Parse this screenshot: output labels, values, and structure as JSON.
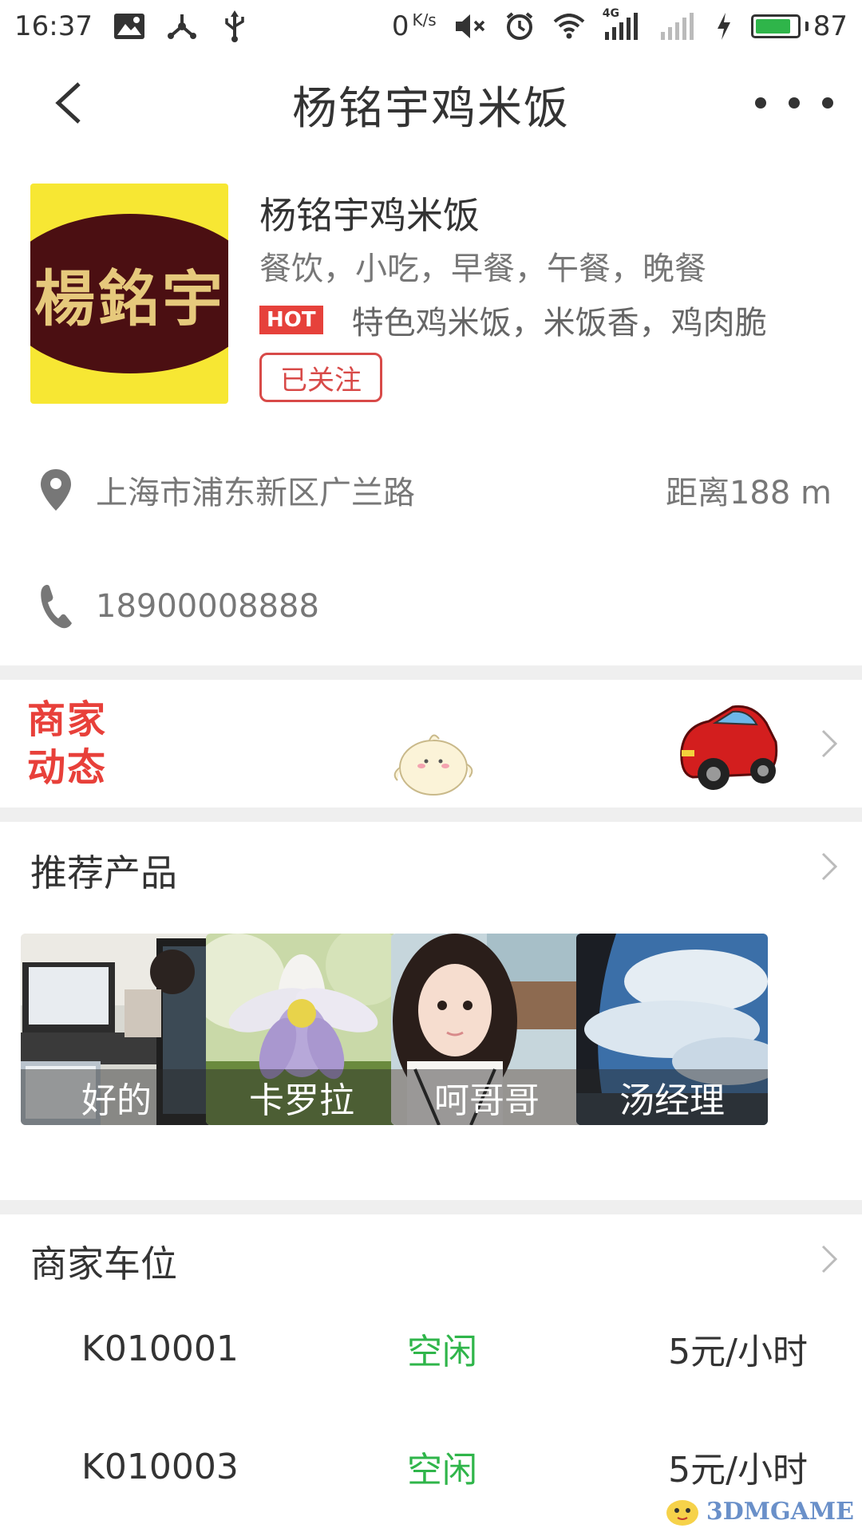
{
  "status_bar": {
    "time": "16:37",
    "net_speed": "0",
    "net_unit": "K/s",
    "battery_level": "87",
    "battery_fraction": 0.87,
    "network": "4G",
    "icons": [
      "image-icon",
      "share-icon",
      "usb-icon",
      "mute-icon",
      "alarm-icon",
      "wifi-icon",
      "signal-icon",
      "signal-empty-icon",
      "charging-icon",
      "battery-icon"
    ]
  },
  "header": {
    "title": "杨铭宇鸡米饭",
    "back_icon": "back-arrow-icon",
    "more_icon": "more-icon"
  },
  "shop": {
    "logo_text": "楊銘宇",
    "name": "杨铭宇鸡米饭",
    "categories": "餐饮，小吃，早餐，午餐，晚餐",
    "hot_badge": "HOT",
    "hot_text": "特色鸡米饭，米饭香，鸡肉脆",
    "follow_label": "已关注"
  },
  "address": {
    "text": "上海市浦东新区广兰路",
    "distance": "距离188 m",
    "icon": "location-pin-icon"
  },
  "phone": {
    "number": "18900008888",
    "icon": "phone-icon"
  },
  "news": {
    "label_line1": "商家",
    "label_line2": "动态"
  },
  "recommended": {
    "title": "推荐产品",
    "products": [
      {
        "name": "好的"
      },
      {
        "name": "卡罗拉"
      },
      {
        "name": "呵哥哥"
      },
      {
        "name": "汤经理"
      }
    ]
  },
  "parking": {
    "title": "商家车位",
    "spots": [
      {
        "id": "K010001",
        "status": "空闲",
        "price": "5元/小时"
      },
      {
        "id": "K010003",
        "status": "空闲",
        "price": "5元/小时"
      }
    ]
  },
  "watermark": "3DMGAME",
  "colors": {
    "accent_red": "#e6413b",
    "status_green": "#2fb54a",
    "divider_gray": "#efefef",
    "logo_yellow": "#f7e733",
    "logo_brown": "#4b0f12"
  }
}
